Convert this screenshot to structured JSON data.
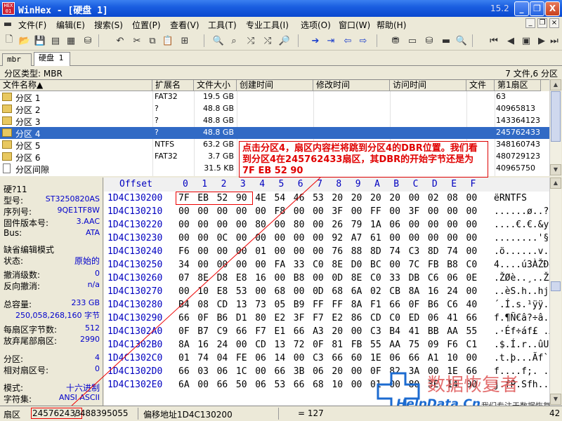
{
  "window": {
    "title": "WinHex - [硬盘 1]",
    "version": "15.2",
    "controls": [
      "_",
      "❐",
      "X"
    ]
  },
  "menu": [
    "文件(F)",
    "编辑(E)",
    "搜索(S)",
    "位置(P)",
    "查看(V)",
    "工具(T)",
    "专业工具(I)",
    "选项(O)",
    "窗口(W)",
    "帮助(H)"
  ],
  "tabs": [
    "mbr",
    "硬盘 1"
  ],
  "partition_info": {
    "type": "分区类型: MBR",
    "files": "7 文件,6 分区"
  },
  "file_list": {
    "headers": [
      "文件名称▲",
      "扩展名",
      "文件大小",
      "创建时间",
      "修改时间",
      "访问时间",
      "文件",
      "第1扇区"
    ],
    "rows": [
      {
        "name": "分区 1",
        "ext": "FAT32",
        "size": "19.5 GB",
        "sector": "63"
      },
      {
        "name": "分区 2",
        "ext": "?",
        "size": "48.8 GB",
        "sector": "40965813"
      },
      {
        "name": "分区 3",
        "ext": "?",
        "size": "48.8 GB",
        "sector": "143364123"
      },
      {
        "name": "分区 4",
        "ext": "?",
        "size": "48.8 GB",
        "sector": "245762433"
      },
      {
        "name": "分区 5",
        "ext": "NTFS",
        "size": "63.2 GB",
        "sector": "348160743"
      },
      {
        "name": "分区 6",
        "ext": "FAT32",
        "size": "3.7 GB",
        "sector": "480729123"
      },
      {
        "name": "分区间隙",
        "ext": "",
        "size": "31.5 KB",
        "sector": "40965750"
      }
    ]
  },
  "info_panel": {
    "disk": "硬?11",
    "model_label": "型号:",
    "model": "ST3250820AS",
    "serial_label": "序列号:",
    "serial": "9QE1TF8W",
    "firmware_label": "固件版本号:",
    "firmware": "3.AAC",
    "bus_label": "Bus:",
    "bus": "ATA",
    "edit_mode_label": "缺省编辑模式",
    "state_label": "状态:",
    "state": "原始的",
    "undo_label": "撤消级数:",
    "undo": "0",
    "redo_label": "反向撤消:",
    "redo": "n/a",
    "capacity_label": "总容量:",
    "capacity": "233 GB",
    "capacity_bytes": "250,058,268,160 字节",
    "bps_label": "每扇区字节数:",
    "bps": "512",
    "spare_label": "放弃尾部扇区:",
    "spare": "2990",
    "partition_label": "分区:",
    "partition": "4",
    "rel_sector_label": "相对扇区号:",
    "rel_sector": "0",
    "mode_label": "模式:",
    "mode": "十六进制",
    "charset_label": "字符集:",
    "charset": "ANSI ASCII"
  },
  "hex": {
    "header": [
      "Offset",
      "0",
      "1",
      "2",
      "3",
      "4",
      "5",
      "6",
      "7",
      "8",
      "9",
      "A",
      "B",
      "C",
      "D",
      "E",
      "F"
    ],
    "rows": [
      {
        "off": "1D4C130200",
        "bytes": [
          "7F",
          "EB",
          "52",
          "90",
          "4E",
          "54",
          "46",
          "53",
          "20",
          "20",
          "20",
          "20",
          "00",
          "02",
          "08",
          "00"
        ],
        "ascii": "ëRNTFS"
      },
      {
        "off": "1D4C130210",
        "bytes": [
          "00",
          "00",
          "00",
          "00",
          "00",
          "F8",
          "00",
          "00",
          "3F",
          "00",
          "FF",
          "00",
          "3F",
          "00",
          "00",
          "00"
        ],
        "ascii": "......ø..?.ÿ.?.."
      },
      {
        "off": "1D4C130220",
        "bytes": [
          "00",
          "00",
          "00",
          "00",
          "80",
          "00",
          "80",
          "00",
          "26",
          "79",
          "1A",
          "06",
          "00",
          "00",
          "00",
          "00"
        ],
        "ascii": "....€.€.&y......"
      },
      {
        "off": "1D4C130230",
        "bytes": [
          "00",
          "00",
          "0C",
          "00",
          "00",
          "00",
          "00",
          "00",
          "92",
          "A7",
          "61",
          "00",
          "00",
          "00",
          "00",
          "00"
        ],
        "ascii": "........'§a....."
      },
      {
        "off": "1D4C130240",
        "bytes": [
          "F6",
          "00",
          "00",
          "00",
          "01",
          "00",
          "00",
          "00",
          "76",
          "88",
          "8D",
          "74",
          "C3",
          "8D",
          "74",
          "00"
        ],
        "ascii": ".ö......v.t.Ã.t"
      },
      {
        "off": "1D4C130250",
        "bytes": [
          "34",
          "00",
          "00",
          "00",
          "00",
          "FA",
          "33",
          "C0",
          "8E",
          "D0",
          "BC",
          "00",
          "7C",
          "FB",
          "B8",
          "C0"
        ],
        "ascii": "4....ú3ÀŽÐ¼.|û¸À"
      },
      {
        "off": "1D4C130260",
        "bytes": [
          "07",
          "8E",
          "D8",
          "E8",
          "16",
          "00",
          "B8",
          "00",
          "0D",
          "8E",
          "C0",
          "33",
          "DB",
          "C6",
          "06",
          "0E"
        ],
        "ascii": ".ŽØè..¸..ŽÀ3ÛÆ.."
      },
      {
        "off": "1D4C130270",
        "bytes": [
          "00",
          "10",
          "E8",
          "53",
          "00",
          "68",
          "00",
          "0D",
          "68",
          "6A",
          "02",
          "CB",
          "8A",
          "16",
          "24",
          "00"
        ],
        "ascii": "..èS.h..hj.Ë.$."
      },
      {
        "off": "1D4C130280",
        "bytes": [
          "B4",
          "08",
          "CD",
          "13",
          "73",
          "05",
          "B9",
          "FF",
          "FF",
          "8A",
          "F1",
          "66",
          "0F",
          "B6",
          "C6",
          "40"
        ],
        "ascii": "´.Í.s.¹ÿÿ.ñf.¶Æ@"
      },
      {
        "off": "1D4C130290",
        "bytes": [
          "66",
          "0F",
          "B6",
          "D1",
          "80",
          "E2",
          "3F",
          "F7",
          "E2",
          "86",
          "CD",
          "C0",
          "ED",
          "06",
          "41",
          "66"
        ],
        "ascii": "f.¶Ñ€â?÷â.ÍÀí.Af"
      },
      {
        "off": "1D4C1302A0",
        "bytes": [
          "0F",
          "B7",
          "C9",
          "66",
          "F7",
          "E1",
          "66",
          "A3",
          "20",
          "00",
          "C3",
          "B4",
          "41",
          "BB",
          "AA",
          "55"
        ],
        "ascii": ".·Éf÷áf£ .Ã´A»ªU"
      },
      {
        "off": "1D4C1302B0",
        "bytes": [
          "8A",
          "16",
          "24",
          "00",
          "CD",
          "13",
          "72",
          "0F",
          "81",
          "FB",
          "55",
          "AA",
          "75",
          "09",
          "F6",
          "C1"
        ],
        "ascii": ".$.Í.r..ûUªu.öÁ"
      },
      {
        "off": "1D4C1302C0",
        "bytes": [
          "01",
          "74",
          "04",
          "FE",
          "06",
          "14",
          "00",
          "C3",
          "66",
          "60",
          "1E",
          "06",
          "66",
          "A1",
          "10",
          "00"
        ],
        "ascii": ".t.þ...Ãf`..f¡.."
      },
      {
        "off": "1D4C1302D0",
        "bytes": [
          "66",
          "03",
          "06",
          "1C",
          "00",
          "66",
          "3B",
          "06",
          "20",
          "00",
          "0F",
          "82",
          "3A",
          "00",
          "1E",
          "66"
        ],
        "ascii": "f....f;. ..‚:..f"
      },
      {
        "off": "1D4C1302E0",
        "bytes": [
          "6A",
          "00",
          "66",
          "50",
          "06",
          "53",
          "66",
          "68",
          "10",
          "00",
          "01",
          "00",
          "80",
          "3E",
          "14",
          "00"
        ],
        "ascii": "j.fP.Sfh....€>.."
      }
    ]
  },
  "annotation": "点击分区4，扇区内容栏将跳到分区4的DBR位置。我们看到分区4在245762433扇区，其DBR的开始字节还是为 7F EB 52 90",
  "watermark": {
    "cn": "数据恢复者",
    "url": "HelpData.Cn",
    "tag": "我们专注于数据恢复"
  },
  "status": {
    "sector_label": "扇区",
    "sector": "245762433",
    "total": "/ 488395055",
    "offset": "偏移地址1D4C130200",
    "value": "= 127",
    "page": "42"
  },
  "colors": {
    "accent": "#0a48cf",
    "selection": "#316ac5",
    "annotation": "#e00000",
    "hex_offset": "#0000c0"
  }
}
